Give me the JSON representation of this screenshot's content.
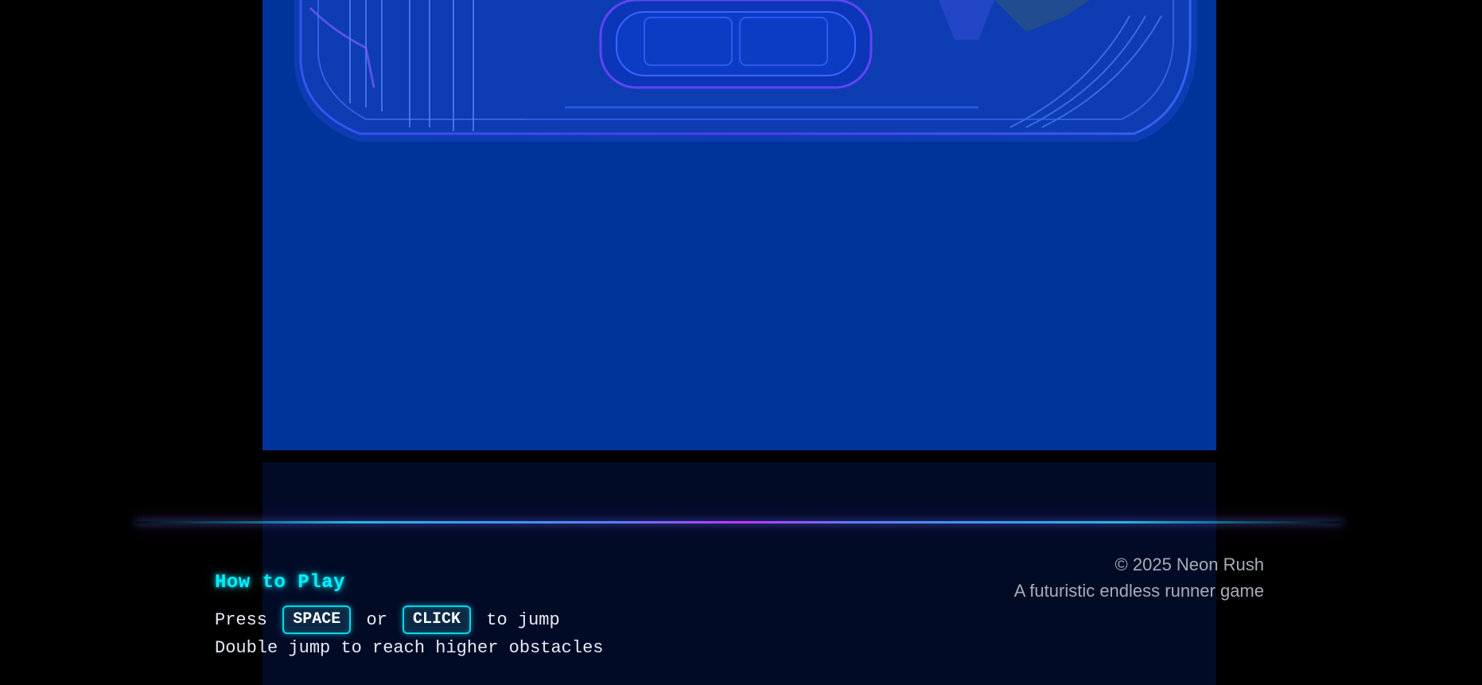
{
  "game": {
    "canvas_color": "#00349a",
    "lower_panel_color": "#020b26",
    "accent_cyan": "#00f0ff",
    "accent_magenta": "#c534ff"
  },
  "how_to_play": {
    "title": "How to Play",
    "line1_prefix": "Press",
    "key_space": "SPACE",
    "line1_or": "or",
    "key_click": "CLICK",
    "line1_suffix": "to jump",
    "line2": "Double jump to reach higher obstacles"
  },
  "footer": {
    "copyright": "© 2025 Neon Rush",
    "tagline": "A futuristic endless runner game"
  }
}
